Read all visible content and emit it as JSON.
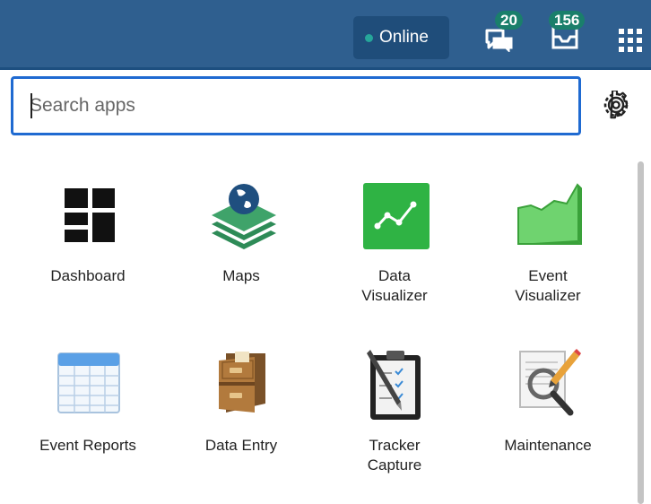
{
  "header": {
    "status": "Online",
    "messages_count": "20",
    "interpretations_count": "156"
  },
  "search": {
    "placeholder": "Search apps",
    "value": ""
  },
  "apps": [
    {
      "label_line1": "Dashboard",
      "label_line2": ""
    },
    {
      "label_line1": "Maps",
      "label_line2": ""
    },
    {
      "label_line1": "Data",
      "label_line2": "Visualizer"
    },
    {
      "label_line1": "Event",
      "label_line2": "Visualizer"
    },
    {
      "label_line1": "Event Reports",
      "label_line2": ""
    },
    {
      "label_line1": "Data Entry",
      "label_line2": ""
    },
    {
      "label_line1": "Tracker",
      "label_line2": "Capture"
    },
    {
      "label_line1": "Maintenance",
      "label_line2": ""
    }
  ],
  "icons": {
    "messages": "chat-icon",
    "interpretations": "inbox-icon",
    "apps_menu": "apps-grid-icon",
    "settings": "gear-icon"
  },
  "colors": {
    "header_bg": "#2f5f8f",
    "status_bg": "#1f4d7a",
    "badge": "#1a7f6b",
    "search_border": "#1f6ad1",
    "online_dot": "#26a69a"
  }
}
